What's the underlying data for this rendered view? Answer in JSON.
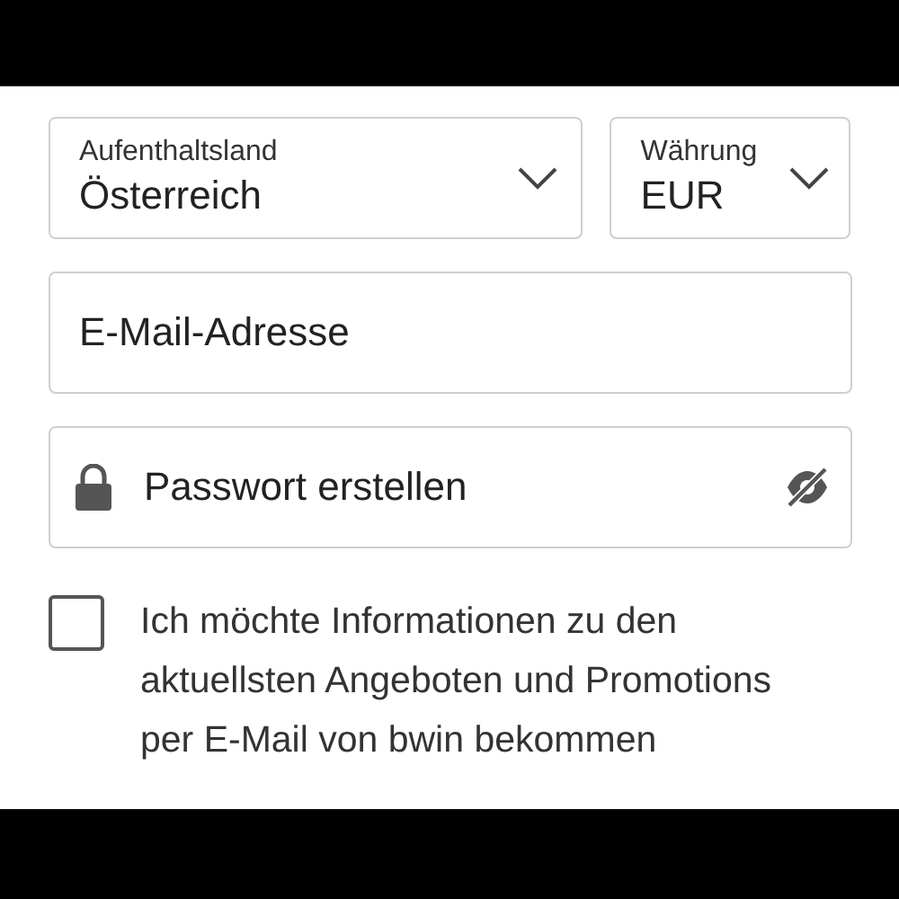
{
  "country": {
    "label": "Aufenthaltsland",
    "value": "Österreich"
  },
  "currency": {
    "label": "Währung",
    "value": "EUR"
  },
  "email": {
    "placeholder": "E-Mail-Adresse"
  },
  "password": {
    "placeholder": "Passwort erstellen",
    "visible": false
  },
  "newsletter": {
    "label": "Ich möchte Informationen zu den aktuellsten Angeboten und Promotions per E-Mail von bwin bekommen",
    "checked": false
  }
}
